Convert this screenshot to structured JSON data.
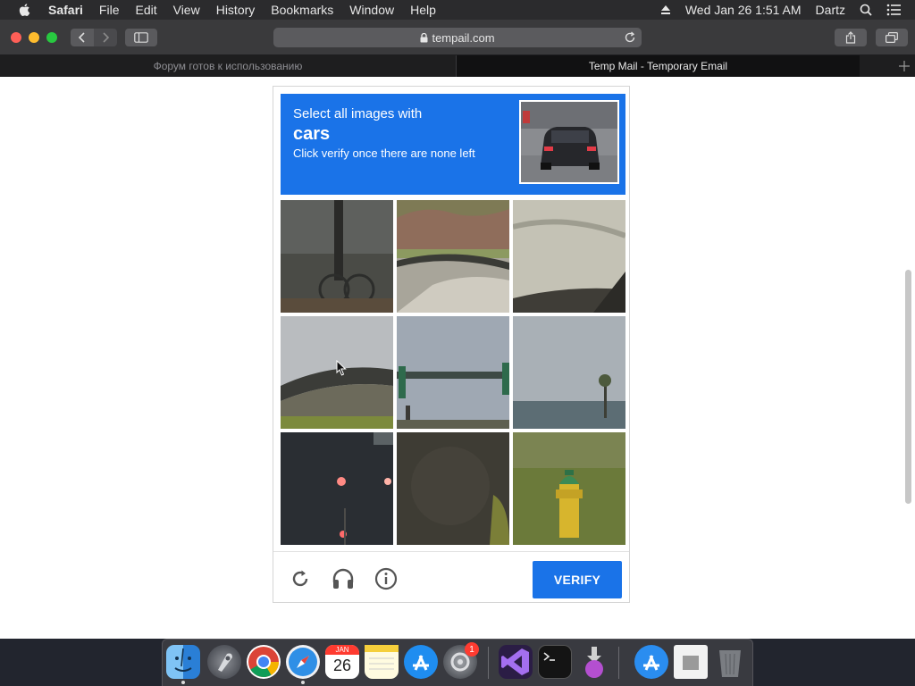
{
  "menubar": {
    "app_name": "Safari",
    "menus": [
      "File",
      "Edit",
      "View",
      "History",
      "Bookmarks",
      "Window",
      "Help"
    ],
    "datetime": "Wed Jan 26  1:51 AM",
    "user": "Dartz"
  },
  "toolbar": {
    "address": "tempail.com"
  },
  "tabs": [
    {
      "title": "Форум готов к использованию",
      "active": false
    },
    {
      "title": "Temp Mail - Temporary Email",
      "active": true
    }
  ],
  "captcha": {
    "line1": "Select all images with",
    "target": "cars",
    "line3": "Click verify once there are none left",
    "verify_label": "VERIFY",
    "tiles": [
      {
        "icon": "bike-rack-image"
      },
      {
        "icon": "road-image"
      },
      {
        "icon": "sky-image"
      },
      {
        "icon": "overpass-image"
      },
      {
        "icon": "traffic-light-pole-image"
      },
      {
        "icon": "palm-sky-image"
      },
      {
        "icon": "night-lights-image"
      },
      {
        "icon": "dark-texture-image"
      },
      {
        "icon": "fire-hydrant-image"
      }
    ]
  },
  "dock": {
    "calendar_month": "JAN",
    "calendar_day": "26",
    "system_prefs_badge": "1"
  }
}
